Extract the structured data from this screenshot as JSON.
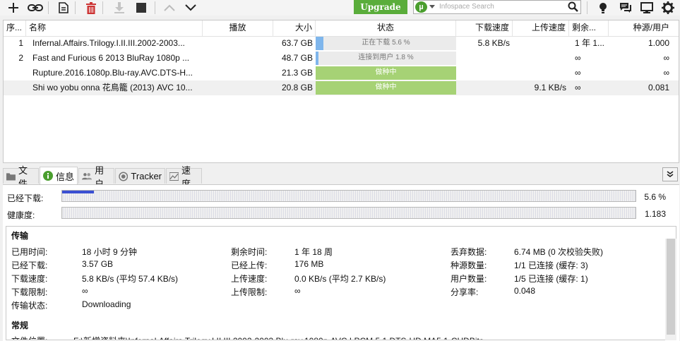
{
  "toolbar": {
    "upgrade_label": "Upgrade",
    "search_placeholder": "Infospace Search",
    "search_logo": "µ"
  },
  "columns": {
    "index": "序...",
    "name": "名称",
    "play": "播放",
    "size": "大小",
    "status": "状态",
    "down_speed": "下载速度",
    "up_speed": "上传速度",
    "remaining": "剩余...",
    "seeds_peers": "种源/用户"
  },
  "torrents": [
    {
      "index": "1",
      "name": "Infernal.Affairs.Trilogy.I.II.III.2002-2003...",
      "size": "63.7 GB",
      "status": "正在下载 5.6 %",
      "progress": 0.056,
      "state": "downloading",
      "down": "5.8 KB/s",
      "up": "",
      "remaining": "1 年 1...",
      "ratio": "1.000"
    },
    {
      "index": "2",
      "name": "Fast and Furious 6 2013 BluRay 1080p ...",
      "size": "48.7 GB",
      "status": "连接到用户 1.8 %",
      "progress": 0.018,
      "state": "connecting",
      "down": "",
      "up": "",
      "remaining": "∞",
      "ratio": "∞"
    },
    {
      "index": "",
      "name": "Rupture.2016.1080p.Blu-ray.AVC.DTS-H...",
      "size": "21.3 GB",
      "status": "做种中",
      "progress": 1.0,
      "state": "seeding",
      "down": "",
      "up": "",
      "remaining": "∞",
      "ratio": "∞"
    },
    {
      "index": "",
      "name": "Shi wo yobu onna 花鳥籠 (2013) AVC 10...",
      "size": "20.8 GB",
      "status": "做种中",
      "progress": 1.0,
      "state": "seeding",
      "down": "",
      "up": "9.1 KB/s",
      "remaining": "∞",
      "ratio": "0.081"
    }
  ],
  "tabs": [
    {
      "label": "文件",
      "icon": "folder-icon"
    },
    {
      "label": "信息",
      "icon": "info-icon"
    },
    {
      "label": "用户",
      "icon": "users-icon"
    },
    {
      "label": "Tracker",
      "icon": "tracker-icon"
    },
    {
      "label": "速度",
      "icon": "speed-chart-icon"
    }
  ],
  "progress_bars": {
    "downloaded_label": "已经下载:",
    "downloaded_value": "5.6 %",
    "downloaded_fraction": 0.056,
    "health_label": "健康度:",
    "health_value": "1.183"
  },
  "transfer": {
    "title": "传输",
    "elapsed_label": "已用时间:",
    "elapsed": "18 小时 9 分钟",
    "downloaded_label": "已经下载:",
    "downloaded": "3.57 GB",
    "dl_speed_label": "下载速度:",
    "dl_speed": "5.8 KB/s (平均 57.4 KB/s)",
    "dl_limit_label": "下载限制:",
    "dl_limit": "∞",
    "state_label": "传输状态:",
    "state": "Downloading",
    "remaining_label": "剩余时间:",
    "remaining": "1 年 18 周",
    "uploaded_label": "已经上传:",
    "uploaded": "176 MB",
    "ul_speed_label": "上传速度:",
    "ul_speed": "0.0 KB/s (平均 2.7 KB/s)",
    "ul_limit_label": "上传限制:",
    "ul_limit": "∞",
    "wasted_label": "丢弃数据:",
    "wasted": "6.74 MB (0 次校验失败)",
    "seeds_label": "种源数量:",
    "seeds": "1/1 已连接 (缓存: 3)",
    "peers_label": "用户数量:",
    "peers": "1/5 已连接 (缓存: 1)",
    "share_label": "分享率:",
    "share": "0.048"
  },
  "general": {
    "title": "常规",
    "save_as_label": "文件位置:",
    "save_as": "F:\\新增资料夹\\Infernal.Affairs.Trilogy.I.II.III.2002-2003.Blu-ray.1080p.AVC.LPCM.5.1.DTS-HD.MA5.1-CHDBits"
  },
  "colors": {
    "upgrade_green": "#5aad3b",
    "seeding_green": "#a6d275",
    "download_blue": "#7fb6ec",
    "progress_blue": "#3a4fd2"
  }
}
